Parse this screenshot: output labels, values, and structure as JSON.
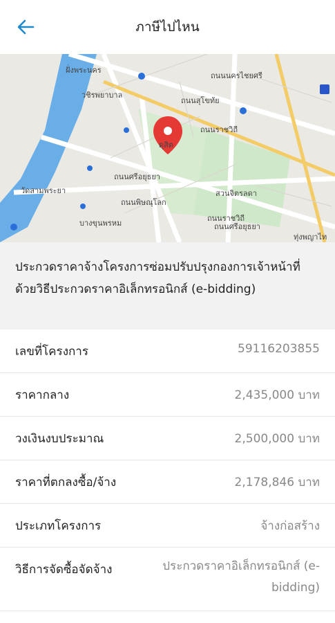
{
  "header": {
    "title": "ภาษีไปไหน",
    "back_icon": "back-arrow-icon",
    "accent": "#1e88c8"
  },
  "map": {
    "labels": {
      "riverside": "ฝั่งพระนคร",
      "hospital": "วชิรพยาบาล",
      "road1": "ถนนนครไชยศรี",
      "road2": "ถนนสุโขทัย",
      "road3": "ถนนราชวิถี",
      "dusit": "ดุสิต",
      "road4": "ถนนศรีอยุธยา",
      "park": "สวนจิตรลดา",
      "road5": "ถนนพิษณุโลก",
      "phraya": "วัดสามพระยา",
      "bangkhun": "บางขุนพรหม",
      "road6": "ถนนศรีอยุธยา",
      "rat": "ถนนราชวิถี",
      "thung": "ทุ่งพญาไท"
    },
    "water_color": "#6aaee8",
    "pin_color": "#e53935"
  },
  "project": {
    "title": "ประกวดราคาจ้างโครงการซ่อมปรับปรุงกองการเจ้าหน้าที่ ด้วยวิธีประกวดราคาอิเล็กทรอนิกส์ (e-bidding)"
  },
  "details": [
    {
      "label": "เลขที่โครงการ",
      "value": "59116203855"
    },
    {
      "label": "ราคากลาง",
      "value": "2,435,000 บาท"
    },
    {
      "label": "วงเงินงบประมาณ",
      "value": "2,500,000 บาท"
    },
    {
      "label": "ราคาที่ตกลงซื้อ/จ้าง",
      "value": "2,178,846 บาท"
    },
    {
      "label": "ประเภทโครงการ",
      "value": "จ้างก่อสร้าง"
    },
    {
      "label": "วิธีการจัดซื้อจัดจ้าง",
      "value": "ประกวดราคาอิเล็กทรอนิกส์ (e-bidding)"
    }
  ]
}
